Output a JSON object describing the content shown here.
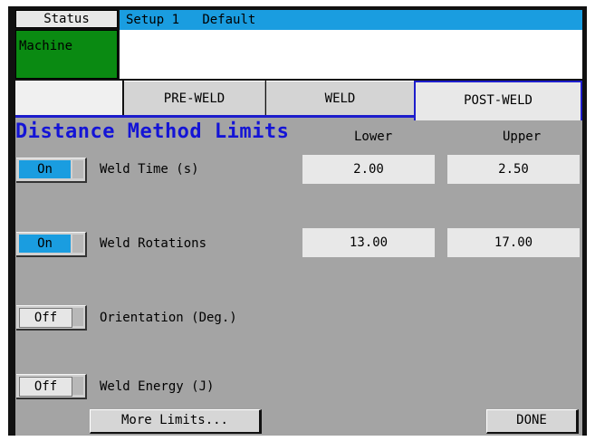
{
  "tabs_top": {
    "status": "Status",
    "machine": "Machine"
  },
  "header": {
    "setup": "Setup 1",
    "config": "Default"
  },
  "tabs": [
    {
      "label": "PRE-WELD"
    },
    {
      "label": "WELD"
    },
    {
      "label": "POST-WELD"
    }
  ],
  "section": {
    "title": "Distance Method Limits",
    "lower_label": "Lower",
    "upper_label": "Upper"
  },
  "rows": [
    {
      "toggle": "On",
      "label": "Weld Time (s)",
      "lower": "2.00",
      "upper": "2.50"
    },
    {
      "toggle": "On",
      "label": "Weld Rotations",
      "lower": "13.00",
      "upper": "17.00"
    },
    {
      "toggle": "Off",
      "label": "Orientation (Deg.)"
    },
    {
      "toggle": "Off",
      "label": "Weld Energy (J)"
    }
  ],
  "footer": {
    "more_limits": "More Limits...",
    "done": "DONE"
  },
  "colors": {
    "accent_blue": "#1a9de0",
    "title_blue": "#1414d6",
    "machine_green": "#0a8a12",
    "panel_gray": "#a4a4a4"
  }
}
